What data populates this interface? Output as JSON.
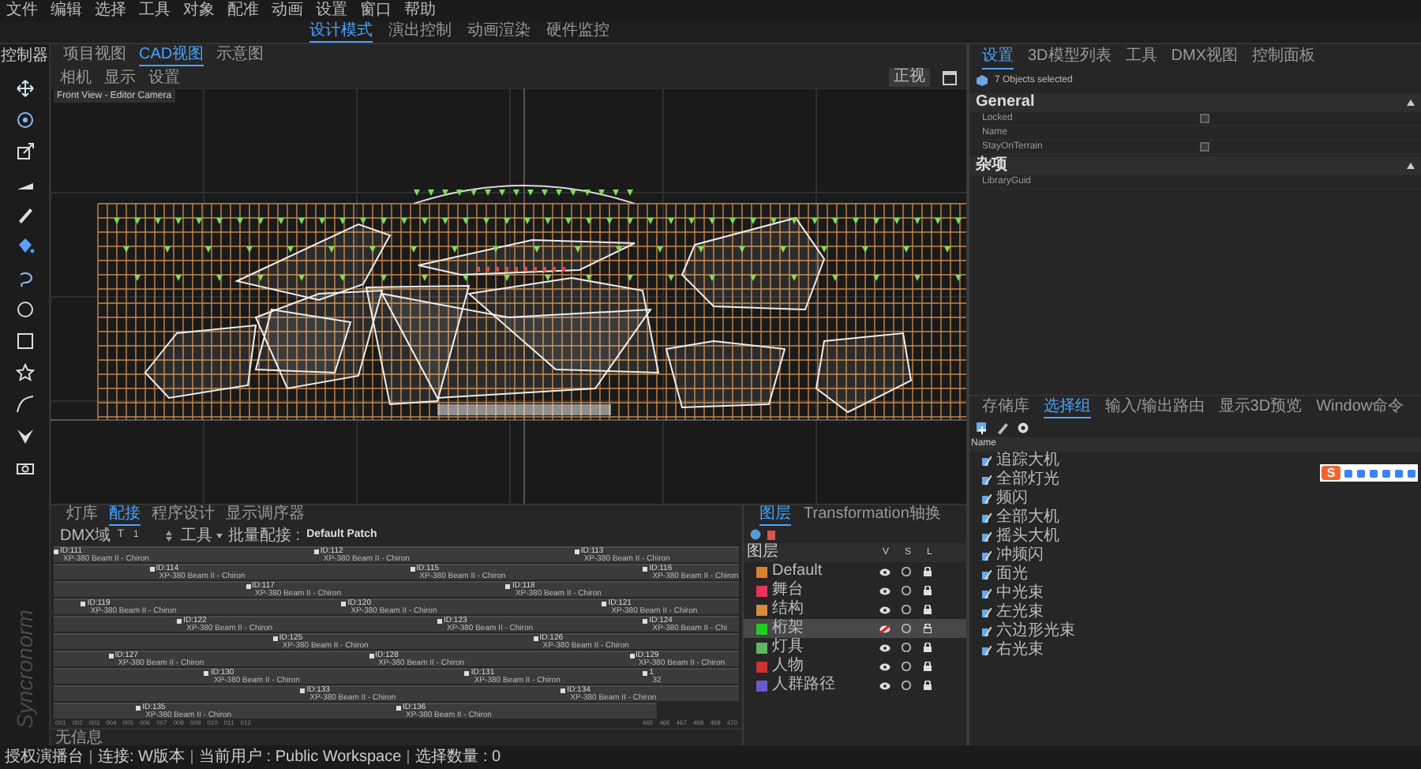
{
  "menu": [
    "文件",
    "编辑",
    "选择",
    "工具",
    "对象",
    "配准",
    "动画",
    "设置",
    "窗口",
    "帮助"
  ],
  "mode_tabs": [
    {
      "label": "设计模式",
      "selected": true
    },
    {
      "label": "演出控制",
      "selected": false
    },
    {
      "label": "动画渲染",
      "selected": false
    },
    {
      "label": "硬件监控",
      "selected": false
    }
  ],
  "left_toolbar": {
    "title": "控制器",
    "logo": "Syncronorm"
  },
  "viewport": {
    "tabs": [
      {
        "label": "项目视图",
        "selected": false
      },
      {
        "label": "CAD视图",
        "selected": true
      },
      {
        "label": "示意图",
        "selected": false
      }
    ],
    "subtabs": [
      "相机",
      "显示",
      "设置"
    ],
    "view_button": "正视",
    "camera_label": "Front View - Editor Camera"
  },
  "properties": {
    "tabs": [
      {
        "label": "设置",
        "selected": true
      },
      {
        "label": "3D模型列表",
        "selected": false
      },
      {
        "label": "工具",
        "selected": false
      },
      {
        "label": "DMX视图",
        "selected": false
      },
      {
        "label": "控制面板",
        "selected": false
      }
    ],
    "selection": "7 Objects selected",
    "sections": [
      {
        "title": "General",
        "rows": [
          {
            "kind": "checkbox",
            "label": "Locked",
            "checked": false
          },
          {
            "kind": "text",
            "label": "Name"
          },
          {
            "kind": "checkbox",
            "label": "StayOnTerrain",
            "checked": false
          }
        ]
      },
      {
        "title": "杂项",
        "rows": [
          {
            "kind": "text",
            "label": "LibraryGuid"
          }
        ]
      }
    ]
  },
  "groups_panel": {
    "tabs": [
      {
        "label": "存储库",
        "selected": false
      },
      {
        "label": "选择组",
        "selected": true
      },
      {
        "label": "输入/输出路由",
        "selected": false
      },
      {
        "label": "显示3D预览",
        "selected": false
      },
      {
        "label": "Window命令",
        "selected": false
      }
    ],
    "column": "Name",
    "items": [
      "追踪大机",
      "全部灯光",
      "频闪",
      "全部大机",
      "摇头大机",
      "冲频闪",
      "面光",
      "中光束",
      "左光束",
      "六边形光束",
      "右光束"
    ]
  },
  "ime_toolbar": {
    "logo": "S"
  },
  "patch": {
    "tabs": [
      {
        "label": "灯库",
        "selected": false
      },
      {
        "label": "配接",
        "selected": true
      },
      {
        "label": "程序设计",
        "selected": false
      },
      {
        "label": "显示调序器",
        "selected": false
      }
    ],
    "universe_label": "DMX域",
    "universe_letter": "T",
    "universe_value": "1",
    "tools": "工具",
    "batch_label": "批量配接 :",
    "batch_value": "Default Patch",
    "fixtures": [
      {
        "id": "ID:111",
        "model": "XP-380 Beam II - Chiron"
      },
      {
        "id": "ID:112",
        "model": "XP-380 Beam II - Chiron"
      },
      {
        "id": "ID:113",
        "model": "XP-380 Beam II - Chiron"
      },
      {
        "id": "ID:114",
        "model": "XP-380 Beam II - Chiron"
      },
      {
        "id": "ID:115",
        "model": "XP-380 Beam II - Chiron"
      },
      {
        "id": "ID:116",
        "model": "XP-380 Beam II - Chiron"
      },
      {
        "id": "ID:117",
        "model": "XP-380 Beam II - Chiron"
      },
      {
        "id": "ID:118",
        "model": "XP-380 Beam II - Chiron"
      },
      {
        "id": "ID:119",
        "model": "XP-380 Beam II - Chiron"
      },
      {
        "id": "ID:120",
        "model": "XP-380 Beam II - Chiron"
      },
      {
        "id": "ID:121",
        "model": "XP-380 Beam II - Chiron"
      },
      {
        "id": "ID:122",
        "model": "XP-380 Beam II - Chiron"
      },
      {
        "id": "ID:123",
        "model": "XP-380 Beam II - Chiron"
      },
      {
        "id": "ID:124",
        "model": "XP-380 Beam II - Chi"
      },
      {
        "id": "ID:125",
        "model": "XP-380 Beam II - Chiron"
      },
      {
        "id": "ID:126",
        "model": "XP-380 Beam II - Chiron"
      },
      {
        "id": "ID:127",
        "model": "XP-380 Beam II - Chiron"
      },
      {
        "id": "ID:128",
        "model": "XP-380 Beam II - Chiron"
      },
      {
        "id": "ID:129",
        "model": "XP-380 Beam II - Chiron"
      },
      {
        "id": "ID:130",
        "model": "XP-380 Beam II - Chiron"
      },
      {
        "id": "ID:131",
        "model": "XP-380 Beam II - Chiron"
      },
      {
        "id": "1",
        "model": "32"
      },
      {
        "id": "ID:133",
        "model": "XP-380 Beam II - Chiron"
      },
      {
        "id": "ID:134",
        "model": "XP-380 Beam II - Chiron"
      },
      {
        "id": "ID:135",
        "model": "XP-380 Beam II - Chiron"
      },
      {
        "id": "ID:136",
        "model": "XP-380 Beam II - Chiron"
      }
    ],
    "scale_start": [
      "001",
      "002",
      "003",
      "004",
      "005",
      "006",
      "007",
      "008",
      "009",
      "010",
      "011",
      "012"
    ],
    "scale_end": [
      "465",
      "466",
      "467",
      "468",
      "469",
      "470"
    ],
    "info": "无信息"
  },
  "layers": {
    "tabs": [
      {
        "label": "图层",
        "selected": true
      },
      {
        "label": "Transformation轴换",
        "selected": false
      }
    ],
    "columns": [
      "图层",
      "V",
      "S",
      "L"
    ],
    "items": [
      {
        "name": "Default",
        "color": "#d9822b",
        "visible": true,
        "locked": true,
        "selected": false
      },
      {
        "name": "舞台",
        "color": "#e8335a",
        "visible": true,
        "locked": true,
        "selected": false
      },
      {
        "name": "结构",
        "color": "#d98a3a",
        "visible": true,
        "locked": true,
        "selected": false
      },
      {
        "name": "桁架",
        "color": "#22cc22",
        "visible": false,
        "locked": false,
        "selected": true
      },
      {
        "name": "灯具",
        "color": "#5cb85c",
        "visible": true,
        "locked": true,
        "selected": false
      },
      {
        "name": "人物",
        "color": "#cc3333",
        "visible": true,
        "locked": true,
        "selected": false
      },
      {
        "name": "人群路径",
        "color": "#6a5acd",
        "visible": true,
        "locked": true,
        "selected": false
      }
    ]
  },
  "status_bar": [
    "授权演播台",
    "连接: W版本",
    "当前用户 : Public Workspace",
    "选择数量 : 0"
  ]
}
